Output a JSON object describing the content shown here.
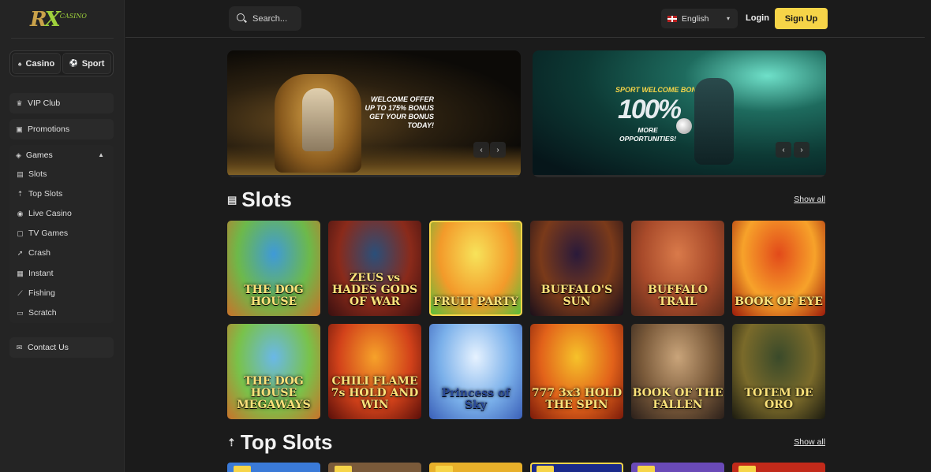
{
  "brand": {
    "logo": "RX",
    "sub": "CASINO"
  },
  "mode": {
    "casino": "Casino",
    "sport": "Sport"
  },
  "sidebar": {
    "vip": "VIP Club",
    "promotions": "Promotions",
    "games": "Games",
    "items": [
      {
        "label": "Slots",
        "icon": "slots-icon"
      },
      {
        "label": "Top Slots",
        "icon": "top-slots-icon"
      },
      {
        "label": "Live Casino",
        "icon": "live-casino-icon"
      },
      {
        "label": "TV Games",
        "icon": "tv-icon"
      },
      {
        "label": "Crash",
        "icon": "rocket-icon"
      },
      {
        "label": "Instant",
        "icon": "instant-icon"
      },
      {
        "label": "Fishing",
        "icon": "fishing-icon"
      },
      {
        "label": "Scratch",
        "icon": "scratch-icon"
      }
    ],
    "contact": "Contact Us"
  },
  "search": {
    "placeholder": "Search..."
  },
  "header": {
    "language": "English",
    "login": "Login",
    "signup": "Sign Up"
  },
  "banners": [
    {
      "text": "WELCOME OFFER\nUP TO 175% BONUS\nGET YOUR BONUS\nTODAY!"
    },
    {
      "title": "SPORT WELCOME BONUS!",
      "big": "100%",
      "text": "MORE\nOPPORTUNITIES!"
    }
  ],
  "sections": {
    "slots": {
      "title": "Slots",
      "show_all": "Show all"
    },
    "top_slots": {
      "title": "Top Slots",
      "show_all": "Show all"
    }
  },
  "games_row1": [
    {
      "name": "THE DOG HOUSE",
      "colors": [
        "#3f9ad8",
        "#6db94a",
        "#c9722a"
      ]
    },
    {
      "name": "ZEUS vs HADES GODS OF WAR",
      "colors": [
        "#2a4f7a",
        "#8a2a1a",
        "#3a1010"
      ]
    },
    {
      "name": "FRUIT PARTY",
      "colors": [
        "#f7e35a",
        "#f39a2a",
        "#4fbf3a"
      ]
    },
    {
      "name": "BUFFALO'S SUN",
      "colors": [
        "#2a1a3a",
        "#7a3a1a",
        "#1a0f1a"
      ]
    },
    {
      "name": "BUFFALO TRAIL",
      "colors": [
        "#d97a4a",
        "#a84a2a",
        "#5a2a1a"
      ]
    },
    {
      "name": "BOOK OF EYE",
      "colors": [
        "#e24a1a",
        "#f7a22a",
        "#9a1a0a"
      ]
    }
  ],
  "games_row2": [
    {
      "name": "THE DOG HOUSE MEGAWAYS",
      "colors": [
        "#6ab8e8",
        "#79c24a",
        "#c9722a"
      ]
    },
    {
      "name": "CHILI FLAME 7s HOLD AND WIN",
      "colors": [
        "#f6a22a",
        "#d2421a",
        "#5a0f0a"
      ]
    },
    {
      "name": "Princess of Sky",
      "colors": [
        "#e6f2ff",
        "#7ab0ea",
        "#3a5fb8"
      ]
    },
    {
      "name": "777 3x3 HOLD THE SPIN",
      "colors": [
        "#f6c22a",
        "#e2621a",
        "#7a1a0a"
      ]
    },
    {
      "name": "BOOK OF THE FALLEN",
      "colors": [
        "#c9a47a",
        "#7a5a3a",
        "#2a1f1a"
      ]
    },
    {
      "name": "TOTEM DE ORO",
      "colors": [
        "#3a4a2a",
        "#7a6a2a",
        "#1a1a10"
      ]
    }
  ],
  "strip_colors": [
    "#3a7ad8",
    "#7a5a3a",
    "#e8b02a",
    "#1a2a8a",
    "#6a4ab8",
    "#c22a1a"
  ]
}
